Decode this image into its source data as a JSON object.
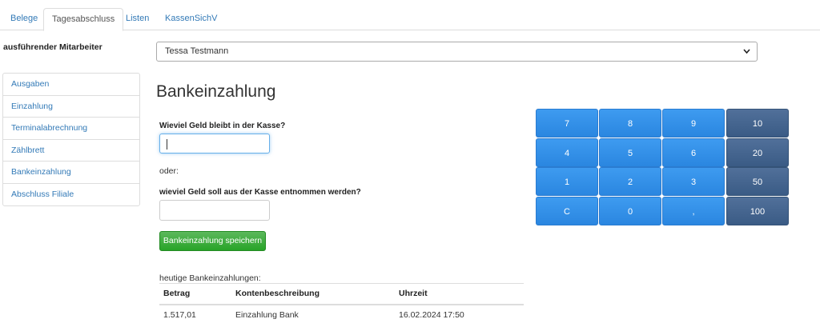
{
  "tabs": [
    "Belege",
    "Tagesabschluss",
    "Listen",
    "KassenSichV"
  ],
  "active_tab": "Tagesabschluss",
  "mitarbeiter": {
    "label": "ausführender Mitarbeiter",
    "selected": "Tessa Testmann"
  },
  "sidebar": {
    "items": [
      "Ausgaben",
      "Einzahlung",
      "Terminalabrechnung",
      "Zählbrett",
      "Bankeinzahlung",
      "Abschluss Filiale"
    ]
  },
  "main": {
    "title": "Bankeinzahlung",
    "question_remaining": "Wieviel Geld bleibt in der Kasse?",
    "remaining_value": "",
    "or_label": "oder:",
    "question_withdraw": "wieviel Geld soll aus der Kasse entnommen werden?",
    "withdraw_value": "",
    "save_label": "Bankeinzahlung speichern"
  },
  "history": {
    "label": "heutige Bankeinzahlungen:",
    "columns": [
      "Betrag",
      "Kontenbeschreibung",
      "Uhrzeit"
    ],
    "rows": [
      [
        "1.517,01",
        "Einzahlung Bank",
        "16.02.2024 17:50"
      ]
    ]
  },
  "keypad": {
    "numbers": [
      "7",
      "8",
      "9",
      "4",
      "5",
      "6",
      "1",
      "2",
      "3",
      "C",
      "0",
      ","
    ],
    "amounts": [
      "10",
      "20",
      "50",
      "100"
    ]
  },
  "colors": {
    "link": "#337ab7",
    "save_button": "#28a428",
    "keypad_number": "#2a86e0",
    "keypad_amount": "#3a5b85"
  }
}
